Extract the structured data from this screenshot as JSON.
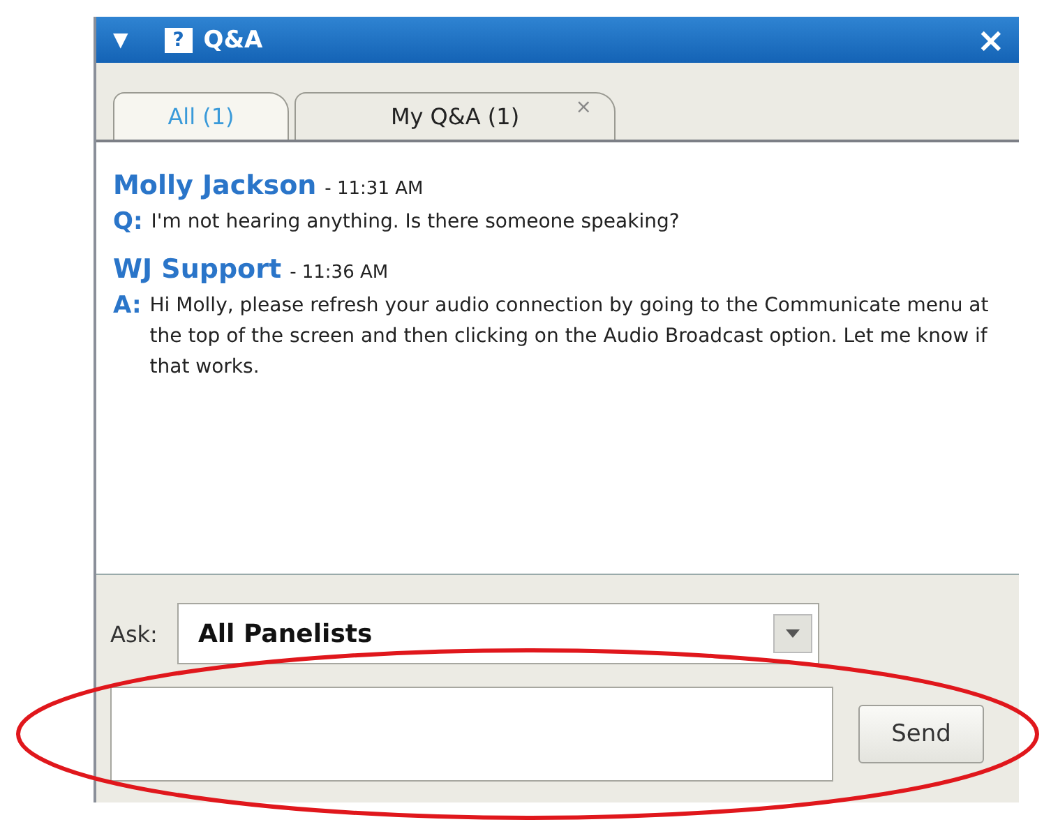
{
  "window": {
    "title": "Q&A",
    "collapse_icon": "▼",
    "help_icon": "?",
    "close_icon": "×"
  },
  "tabs": [
    {
      "label": "All (1)",
      "selected": true
    },
    {
      "label": "My Q&A (1)",
      "selected": false,
      "close_icon": "×"
    }
  ],
  "messages": [
    {
      "author": "Molly Jackson",
      "time": "- 11:31 AM",
      "prefix": "Q:",
      "text": "I'm not hearing anything. Is there someone speaking?"
    },
    {
      "author": "WJ Support",
      "time": "- 11:36 AM",
      "prefix": "A:",
      "text": "Hi Molly, please refresh your audio connection by going to the Communicate menu at the top of the screen and then clicking on the Audio Broadcast option. Let me know if that works."
    }
  ],
  "ask": {
    "label": "Ask:",
    "value": "All Panelists"
  },
  "send_button": "Send",
  "annotation": {
    "kind": "ellipse",
    "color": "#e0171c"
  }
}
